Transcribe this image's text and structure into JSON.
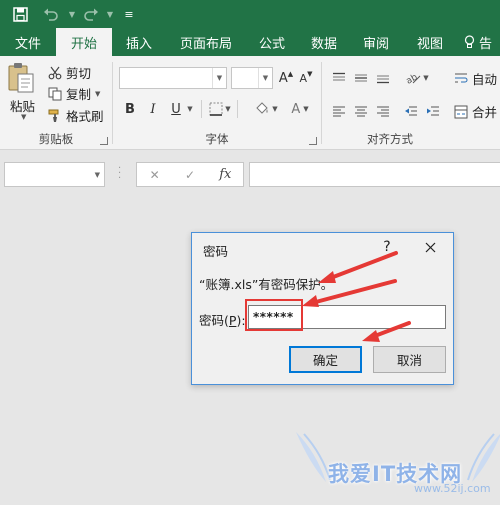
{
  "qat": {
    "save_icon": "save-icon",
    "undo_icon": "undo-icon",
    "redo_icon": "redo-icon",
    "more_label": "≡"
  },
  "tabs": [
    {
      "label": "文件"
    },
    {
      "label": "开始"
    },
    {
      "label": "插入"
    },
    {
      "label": "页面布局"
    },
    {
      "label": "公式"
    },
    {
      "label": "数据"
    },
    {
      "label": "审阅"
    },
    {
      "label": "视图"
    },
    {
      "label": "告"
    }
  ],
  "ribbon": {
    "clipboard": {
      "paste_label": "粘贴",
      "cut_label": "剪切",
      "copy_label": "复制",
      "format_painter_label": "格式刷",
      "group_label": "剪贴板"
    },
    "font": {
      "group_label": "字体",
      "grow_label": "A",
      "shrink_label": "A",
      "bold_label": "B",
      "italic_label": "I",
      "underline_label": "U",
      "font_color_label": "A"
    },
    "align": {
      "group_label": "对齐方式",
      "wrap_label": "自动",
      "merge_label": "合并"
    }
  },
  "formula_bar": {
    "fx_label": "fx",
    "cancel_label": "✕",
    "enter_label": "✓"
  },
  "dialog": {
    "title": "密码",
    "help_label": "?",
    "message": "“账簿.xls”有密码保护。",
    "password_label_prefix": "密码(",
    "password_label_key": "P",
    "password_label_suffix": "):",
    "password_value": "******",
    "ok_label": "确定",
    "cancel_label": "取消"
  },
  "watermark": {
    "text": "我爱IT技术网",
    "url": "www.52ij.com"
  },
  "colors": {
    "brand": "#217346",
    "annotation_red": "#e53935",
    "focus_blue": "#0078d7"
  }
}
